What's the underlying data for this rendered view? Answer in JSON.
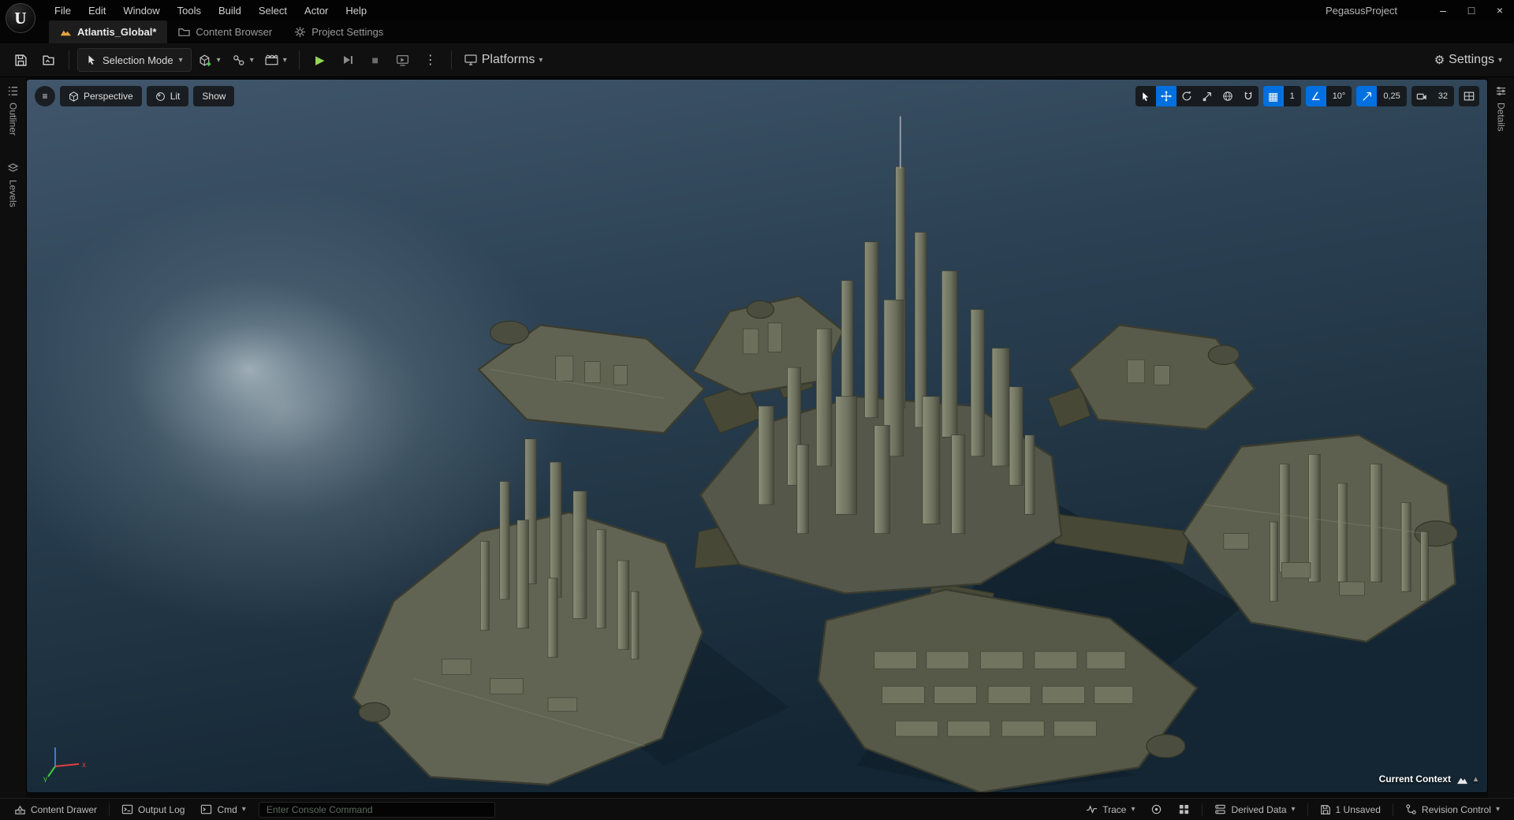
{
  "window": {
    "project_name": "PegasusProject",
    "menu": [
      "File",
      "Edit",
      "Window",
      "Tools",
      "Build",
      "Select",
      "Actor",
      "Help"
    ]
  },
  "tabs": {
    "asset_tab": "Atlantis_Global*",
    "content_browser": "Content Browser",
    "project_settings": "Project Settings"
  },
  "toolbar": {
    "selection_mode": "Selection Mode",
    "platforms": "Platforms",
    "settings": "Settings"
  },
  "viewport": {
    "perspective": "Perspective",
    "lit": "Lit",
    "show": "Show",
    "grid_snap_value": "1",
    "rotation_snap_value": "10°",
    "scale_snap_value": "0,25",
    "camera_speed_value": "32",
    "current_context": "Current Context"
  },
  "panels": {
    "outliner": "Outliner",
    "levels": "Levels",
    "details": "Details"
  },
  "statusbar": {
    "content_drawer": "Content Drawer",
    "output_log": "Output Log",
    "cmd": "Cmd",
    "console_placeholder": "Enter Console Command",
    "trace": "Trace",
    "derived_data": "Derived Data",
    "unsaved": "1 Unsaved",
    "revision_control": "Revision Control"
  },
  "icons": {
    "hamburger": "≡",
    "caret": "▾",
    "caret_up": "▴",
    "dots": "⋮",
    "grid": "▦",
    "angle": "∠",
    "play": "▶",
    "stop": "■",
    "gear": "⚙",
    "minimize": "–",
    "maximize": "□",
    "close": "×",
    "logo_letter": "U"
  },
  "colors": {
    "accent_blue": "#0070e0",
    "play_green": "#95d65a",
    "asset_icon_orange": "#e8a33d",
    "placeholder_green": "#5c6b60"
  }
}
